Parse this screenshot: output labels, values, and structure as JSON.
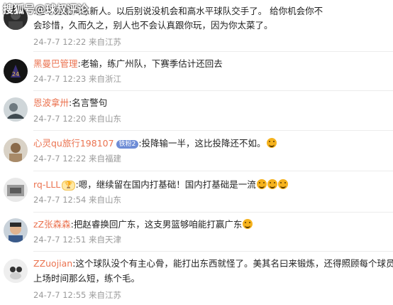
{
  "watermark": "搜狐号@球叔评论",
  "comments": [
    {
      "user": "",
      "text": ":走个秀就叫练新人。以后别说没机会和高水平球队交手了。给你机会你不会珍惜，久而久之，别人也不会认真跟你玩，因为你太菜了。",
      "line1": ":走个秀就叫练新人。以后别说没机会和高水平球队交手了。 给你机会你不",
      "line2": "会珍惜，久而久之，别人也不会认真跟你玩，因为你太菜了。",
      "meta": "24-7-7 12:22 来自江苏"
    },
    {
      "user": "黑曼巴管理",
      "text": ":老输，练广州队，下赛季估计还回去",
      "meta": "24-7-7 12:23 来自浙江"
    },
    {
      "user": "恩波拿卅",
      "text": ":名言警句",
      "meta": "24-7-7 12:20 来自山东"
    },
    {
      "user": "心灵qu旅行198107",
      "badge": "铁粉2",
      "text": ":投降输一半，这比投降还不如。",
      "emojis": 1,
      "meta": "24-7-7 12:22 来自福建"
    },
    {
      "user": "rq-LLL",
      "badge": "🏆",
      "text": ":嗯，继续留在国内打基础！国内打基础是一流",
      "emojis": 3,
      "meta": "24-7-7 12:54 来自山东"
    },
    {
      "user": "zZ张森森",
      "text": ":把赵睿换回广东，这支男篮够咱能打赢广东",
      "emojis": 1,
      "meta": "24-7-7 12:51 来自天津"
    },
    {
      "user": "ZZuojian",
      "text": ":这个球队没个有主心骨，能打出东西就怪了。美其名曰来锻炼，还得照顾每个球员，上场时间那么短，练个毛。",
      "line1": ":这个球队没个有主心骨，能打出东西就怪了。美其名曰来锻炼，还得照顾每个球员，",
      "line2": "上场时间那么短，练个毛。",
      "meta": "24-7-7 12:55 来自江苏"
    }
  ]
}
